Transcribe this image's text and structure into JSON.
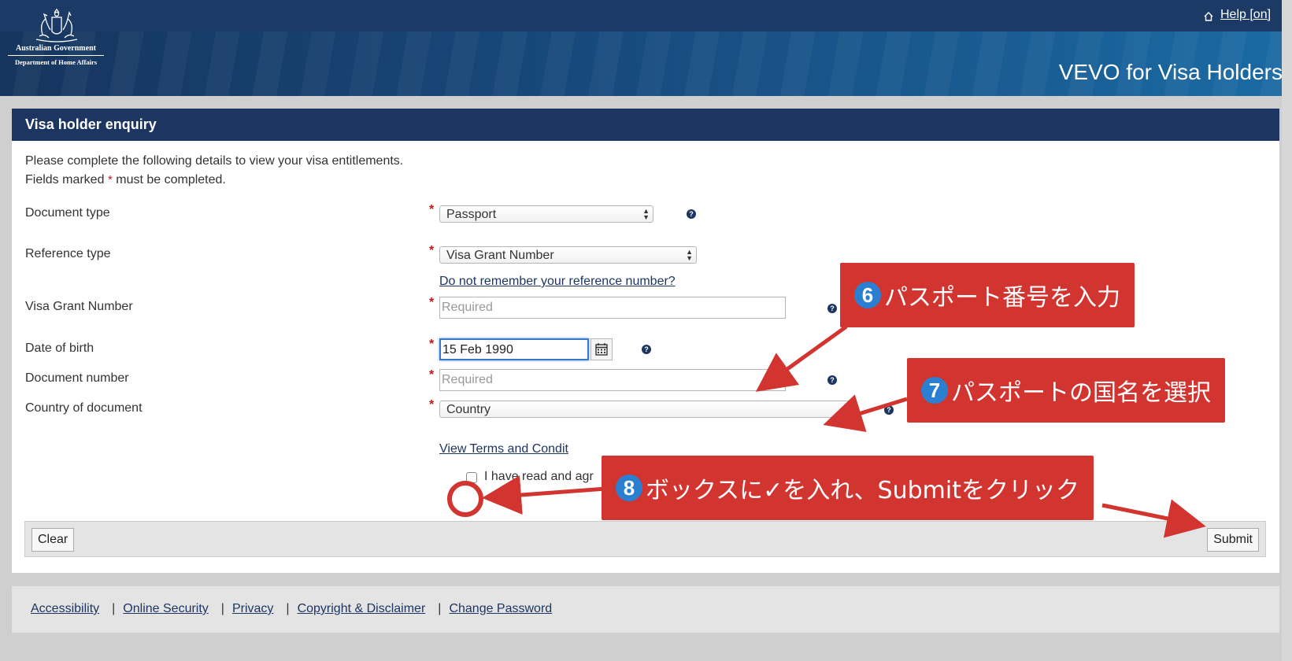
{
  "header": {
    "gov_line1": "Australian Government",
    "gov_line2": "Department of Home Affairs",
    "help_label": "Help [on]",
    "app_title": "VEVO for Visa Holders"
  },
  "panel": {
    "title": "Visa holder enquiry",
    "intro_line1": "Please complete the following details to view your visa entitlements.",
    "intro_line2_before": "Fields marked",
    "intro_line2_star": "*",
    "intro_line2_after": "must be completed."
  },
  "form": {
    "star": "*",
    "help_glyph": "?",
    "document_type": {
      "label": "Document type",
      "value": "Passport"
    },
    "reference_type": {
      "label": "Reference type",
      "value": "Visa Grant Number"
    },
    "forgot_link": "Do not remember your reference number?",
    "visa_grant_number": {
      "label": "Visa Grant Number",
      "placeholder": "Required"
    },
    "date_of_birth": {
      "label": "Date of birth",
      "value": "15 Feb 1990"
    },
    "document_number": {
      "label": "Document number",
      "placeholder": "Required"
    },
    "country_of_document": {
      "label": "Country of document",
      "value": "Country"
    },
    "terms_link": "View Terms and Condit",
    "agree_text": "I have read and agr"
  },
  "buttons": {
    "clear": "Clear",
    "submit": "Submit"
  },
  "footer": {
    "links": [
      "Accessibility",
      "Online Security",
      "Privacy",
      "Copyright & Disclaimer",
      "Change Password"
    ],
    "separator": "|"
  },
  "annotations": {
    "step6": {
      "number": "6",
      "text": "パスポート番号を入力"
    },
    "step7": {
      "number": "7",
      "text": "パスポートの国名を選択"
    },
    "step8": {
      "number": "8",
      "text": "ボックスに✓を入れ、Submitをクリック"
    },
    "accent_color": "#d23430",
    "badge_color": "#2b7fd0"
  }
}
